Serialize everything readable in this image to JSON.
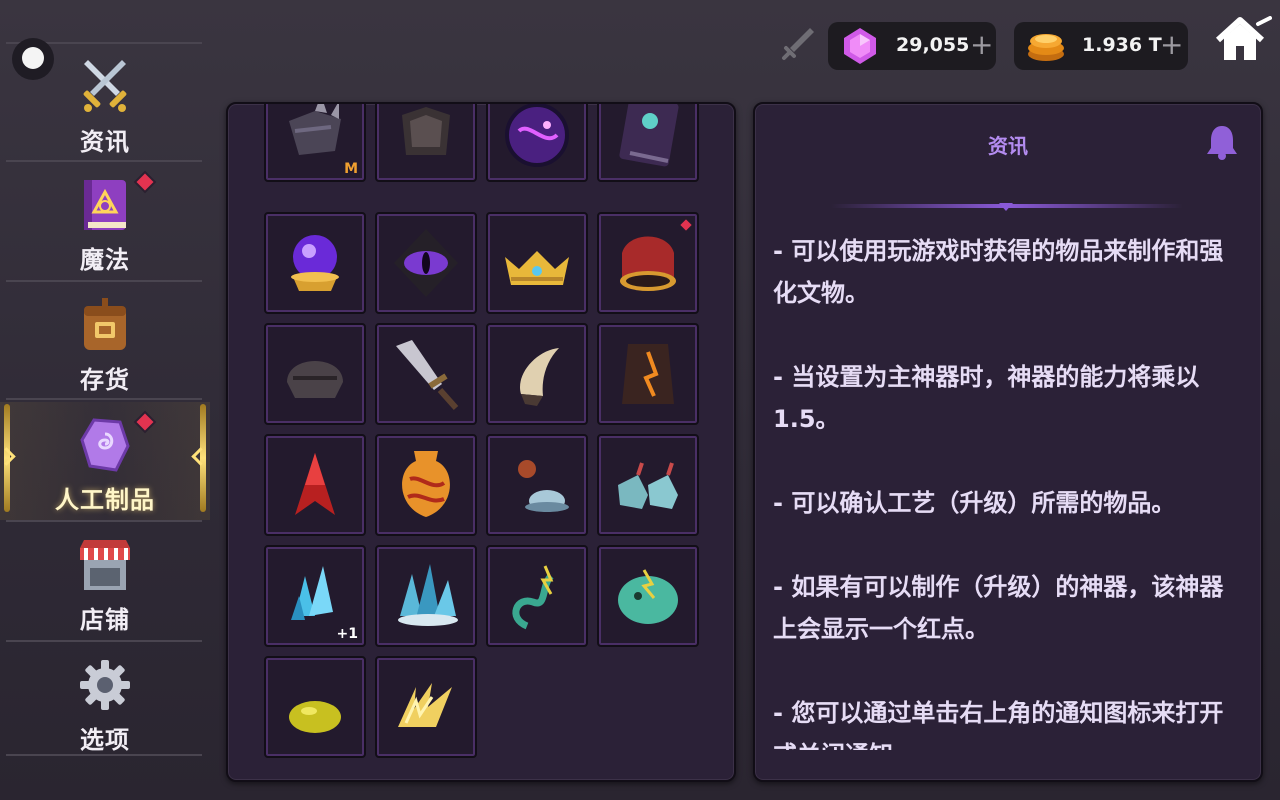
{
  "sidebar": {
    "items": [
      {
        "label": "资讯",
        "icon": "crossed-swords-icon",
        "has_dot": false
      },
      {
        "label": "魔法",
        "icon": "spellbook-icon",
        "has_dot": true
      },
      {
        "label": "存货",
        "icon": "backpack-icon",
        "has_dot": false
      },
      {
        "label": "人工制品",
        "icon": "artifact-rune-stone-icon",
        "has_dot": true,
        "active": true
      },
      {
        "label": "店铺",
        "icon": "shop-stall-icon",
        "has_dot": false
      },
      {
        "label": "选项",
        "icon": "gear-icon",
        "has_dot": false
      }
    ]
  },
  "topbar": {
    "gems": {
      "value": "29,055",
      "icon": "purple-gem-icon",
      "plus": "+"
    },
    "gold": {
      "value": "1.936 T",
      "icon": "gold-coin-stack-icon",
      "plus": "+"
    },
    "home_icon": "home-icon",
    "sword_icon": "sword-icon"
  },
  "artifacts": [
    {
      "name": "dark-claw-gauntlet",
      "badge": "M",
      "badge_type": "m"
    },
    {
      "name": "shadow-chest-armor"
    },
    {
      "name": "cosmic-orb"
    },
    {
      "name": "dark-grimoire"
    },
    {
      "name": "crystal-ball-on-stand"
    },
    {
      "name": "evil-eye-sigil"
    },
    {
      "name": "golden-crown"
    },
    {
      "name": "ruby-royal-crown",
      "red_dot": true
    },
    {
      "name": "dark-helmet"
    },
    {
      "name": "broken-sword"
    },
    {
      "name": "beast-claw"
    },
    {
      "name": "flame-cloak"
    },
    {
      "name": "red-dragon-wing"
    },
    {
      "name": "lava-vase"
    },
    {
      "name": "planet-and-rock"
    },
    {
      "name": "frost-boots"
    },
    {
      "name": "blue-crystal-shard",
      "badge": "+1",
      "badge_type": "plus"
    },
    {
      "name": "ice-crystal-cluster"
    },
    {
      "name": "lightning-serpent"
    },
    {
      "name": "green-slime-beast"
    },
    {
      "name": "yellow-slime"
    },
    {
      "name": "lightning-wing"
    }
  ],
  "info": {
    "title": "资讯",
    "bell_icon": "bell-icon",
    "paragraphs": [
      "- 可以使用玩游戏时获得的物品来制作和强化文物。",
      "- 当设置为主神器时，神器的能力将乘以 1.5。",
      "- 可以确认工艺（升级）所需的物品。",
      "- 如果有可以制作（升级）的神器，该神器上会显示一个红点。",
      "- 您可以通过单击右上角的通知图标来打开或关闭通知"
    ]
  },
  "colors": {
    "accent": "#b48cf0",
    "red_dot": "#e23350",
    "gold": "#ffe27a"
  }
}
